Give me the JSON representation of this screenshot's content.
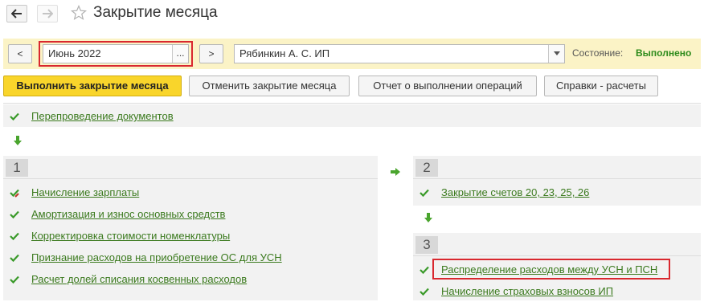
{
  "window": {
    "title": "Закрытие месяца",
    "back_icon": "arrow-left-icon",
    "forward_icon": "arrow-right-icon",
    "favorite_icon": "star-icon"
  },
  "form": {
    "prev_label": "<",
    "period_value": "Июнь 2022",
    "period_picker_label": "...",
    "next_label": ">",
    "org_value": "Рябинкин А. С. ИП",
    "state_label": "Состояние:",
    "state_value": "Выполнено"
  },
  "commands": {
    "run": "Выполнить закрытие месяца",
    "cancel": "Отменить закрытие месяца",
    "report": "Отчет о выполнении операций",
    "references": "Справки - расчеты"
  },
  "top_item": "Перепроведение документов",
  "step1": {
    "number": "1",
    "items": [
      "Начисление зарплаты",
      "Амортизация и износ основных средств",
      "Корректировка стоимости номенклатуры",
      "Признание расходов на приобретение ОС для УСН",
      "Расчет долей списания косвенных расходов"
    ]
  },
  "step2": {
    "number": "2",
    "items": [
      "Закрытие счетов 20, 23, 25, 26"
    ]
  },
  "step3": {
    "number": "3",
    "items": [
      "Распределение расходов между УСН и ПСН",
      "Начисление страховых взносов ИП"
    ]
  },
  "colors": {
    "accent_yellow": "#f9d52b",
    "form_bar": "#fbf3c6",
    "link_green": "#3b7a1e",
    "status_green": "#2c8a1a",
    "highlight_red": "#d9282f"
  }
}
